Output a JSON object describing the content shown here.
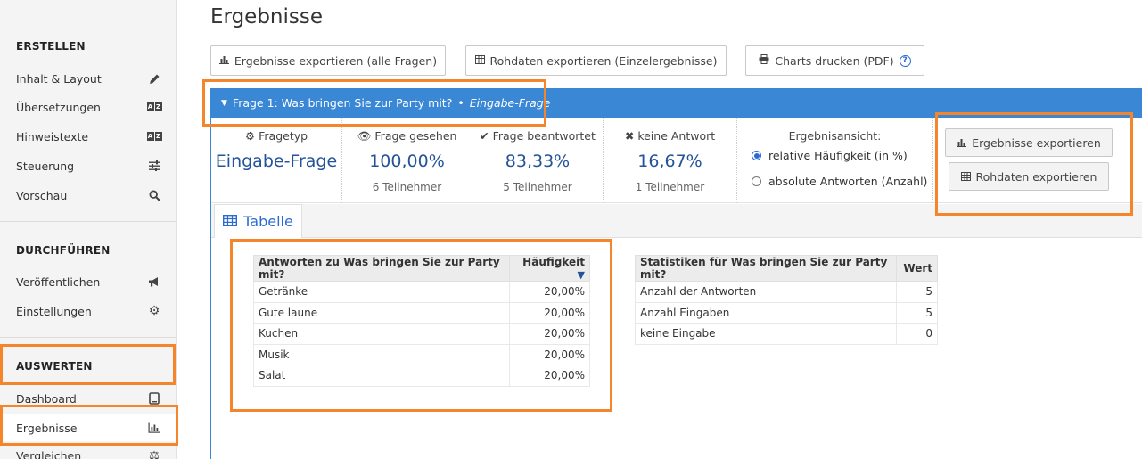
{
  "sidebar": {
    "sections": [
      {
        "title": "ERSTELLEN"
      },
      {
        "title": "DURCHFÜHREN"
      },
      {
        "title": "AUSWERTEN"
      }
    ],
    "items": [
      {
        "label": "Inhalt & Layout",
        "icon": "pencil-icon"
      },
      {
        "label": "Übersetzungen",
        "icon": "translate-icon"
      },
      {
        "label": "Hinweistexte",
        "icon": "translate-icon"
      },
      {
        "label": "Steuerung",
        "icon": "sliders-icon"
      },
      {
        "label": "Vorschau",
        "icon": "search-icon"
      },
      {
        "label": "Veröffentlichen",
        "icon": "megaphone-icon"
      },
      {
        "label": "Einstellungen",
        "icon": "gear-icon"
      },
      {
        "label": "Dashboard",
        "icon": "tablet-icon"
      },
      {
        "label": "Ergebnisse",
        "icon": "bar-chart-icon"
      },
      {
        "label": "Vergleichen",
        "icon": "scale-icon"
      }
    ]
  },
  "page_title": "Ergebnisse",
  "toolbar": {
    "export_all": "Ergebnisse exportieren (alle Fragen)",
    "export_raw": "Rohdaten exportieren (Einzelergebnisse)",
    "print": "Charts drucken (PDF)"
  },
  "question": {
    "title": "Frage 1: Was bringen Sie zur Party mit?",
    "bullet": "•",
    "type_label": "Eingabe-Frage"
  },
  "stats": {
    "type": {
      "label": "Fragetyp",
      "value": "Eingabe-Frage"
    },
    "seen": {
      "label": "Frage gesehen",
      "value": "100,00%",
      "sub": "6 Teilnehmer"
    },
    "answered": {
      "label": "Frage beantwortet",
      "value": "83,33%",
      "sub": "5 Teilnehmer"
    },
    "none": {
      "label": "keine Antwort",
      "value": "16,67%",
      "sub": "1 Teilnehmer"
    }
  },
  "view": {
    "label": "Ergebnisansicht:",
    "option_relative": "relative Häufigkeit (in %)",
    "option_absolute": "absolute Antworten (Anzahl)",
    "selected": "relative"
  },
  "side_buttons": {
    "export": "Ergebnisse exportieren",
    "raw": "Rohdaten exportieren"
  },
  "tab": {
    "label": "Tabelle"
  },
  "answers_table": {
    "headers": [
      "Antworten zu Was bringen Sie zur Party mit?",
      "Häufigkeit"
    ],
    "sort_indicator": "▼",
    "rows": [
      [
        "Getränke",
        "20,00%"
      ],
      [
        "Gute laune",
        "20,00%"
      ],
      [
        "Kuchen",
        "20,00%"
      ],
      [
        "Musik",
        "20,00%"
      ],
      [
        "Salat",
        "20,00%"
      ]
    ]
  },
  "stats_table": {
    "headers": [
      "Statistiken für Was bringen Sie zur Party mit?",
      "Wert"
    ],
    "rows": [
      [
        "Anzahl der Antworten",
        "5"
      ],
      [
        "Anzahl Eingaben",
        "5"
      ],
      [
        "keine Eingabe",
        "0"
      ]
    ]
  },
  "colors": {
    "accent": "#3a87d6",
    "highlight": "#f5852a",
    "value": "#24539a"
  }
}
